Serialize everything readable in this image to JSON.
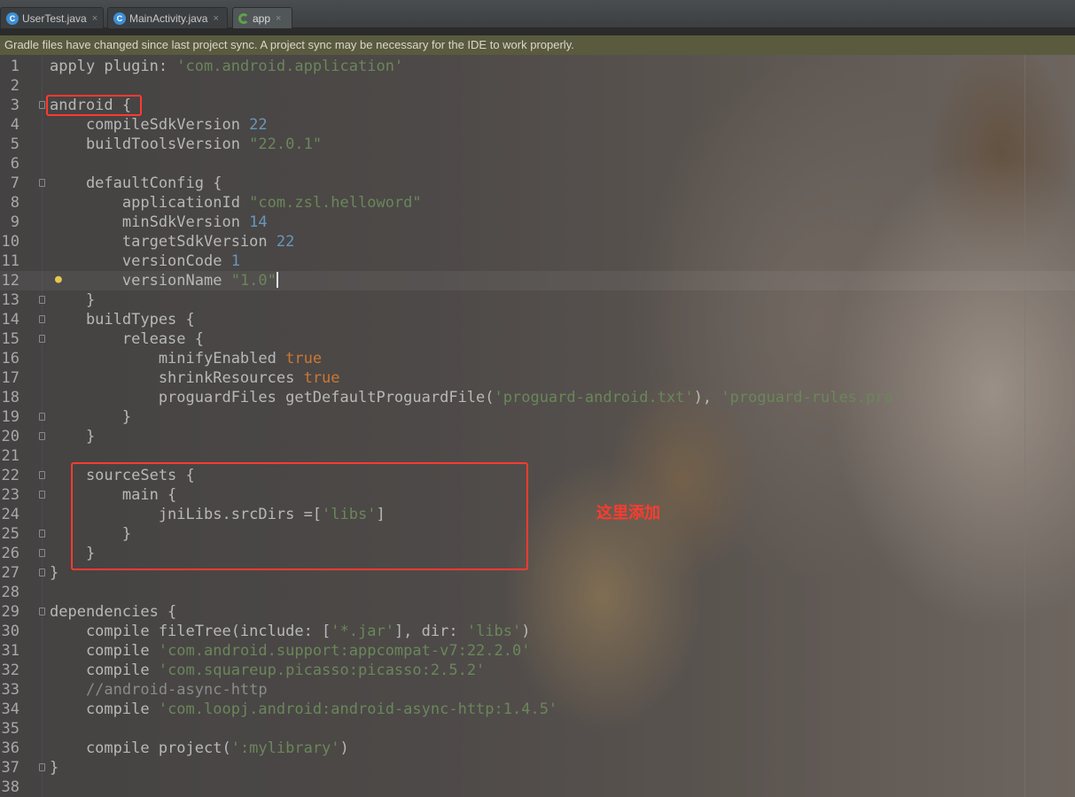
{
  "tabs": [
    {
      "label": "UserTest.java",
      "icon": "class-c-icon"
    },
    {
      "label": "MainActivity.java",
      "icon": "class-c-icon"
    },
    {
      "label": "app",
      "icon": "gradle-icon",
      "active": true
    }
  ],
  "close_glyph": "×",
  "notice": "Gradle files have changed since last project sync. A project sync may be necessary for the IDE to work properly.",
  "annotation": "这里添加",
  "editor": {
    "current_line": 12,
    "lines": [
      {
        "n": "1",
        "tokens": [
          [
            "txt",
            "apply plugin: "
          ],
          [
            "str",
            "'com.android.application'"
          ]
        ]
      },
      {
        "n": "2",
        "tokens": []
      },
      {
        "n": "3",
        "fold": true,
        "tokens": [
          [
            "txt",
            "android {"
          ]
        ]
      },
      {
        "n": "4",
        "tokens": [
          [
            "txt",
            "    compileSdkVersion "
          ],
          [
            "num",
            "22"
          ]
        ]
      },
      {
        "n": "5",
        "tokens": [
          [
            "txt",
            "    buildToolsVersion "
          ],
          [
            "str",
            "\"22.0.1\""
          ]
        ]
      },
      {
        "n": "6",
        "tokens": []
      },
      {
        "n": "7",
        "fold": true,
        "tokens": [
          [
            "txt",
            "    defaultConfig {"
          ]
        ]
      },
      {
        "n": "8",
        "tokens": [
          [
            "txt",
            "        applicationId "
          ],
          [
            "str",
            "\"com.zsl.helloword\""
          ]
        ]
      },
      {
        "n": "9",
        "tokens": [
          [
            "txt",
            "        minSdkVersion "
          ],
          [
            "num",
            "14"
          ]
        ]
      },
      {
        "n": "10",
        "tokens": [
          [
            "txt",
            "        targetSdkVersion "
          ],
          [
            "num",
            "22"
          ]
        ]
      },
      {
        "n": "11",
        "tokens": [
          [
            "txt",
            "        versionCode "
          ],
          [
            "num",
            "1"
          ]
        ]
      },
      {
        "n": "12",
        "bulb": true,
        "caret": true,
        "tokens": [
          [
            "txt",
            "        versionName "
          ],
          [
            "str",
            "\"1.0\""
          ]
        ]
      },
      {
        "n": "13",
        "fold": true,
        "tokens": [
          [
            "txt",
            "    }"
          ]
        ]
      },
      {
        "n": "14",
        "fold": true,
        "tokens": [
          [
            "txt",
            "    buildTypes {"
          ]
        ]
      },
      {
        "n": "15",
        "fold": true,
        "tokens": [
          [
            "txt",
            "        release {"
          ]
        ]
      },
      {
        "n": "16",
        "tokens": [
          [
            "txt",
            "            minifyEnabled "
          ],
          [
            "kw",
            "true"
          ]
        ]
      },
      {
        "n": "17",
        "tokens": [
          [
            "txt",
            "            shrinkResources "
          ],
          [
            "kw",
            "true"
          ]
        ]
      },
      {
        "n": "18",
        "tokens": [
          [
            "txt",
            "            proguardFiles getDefaultProguardFile("
          ],
          [
            "str",
            "'proguard-android.txt'"
          ],
          [
            "txt",
            "), "
          ],
          [
            "str",
            "'proguard-rules.pro'"
          ]
        ]
      },
      {
        "n": "19",
        "fold": true,
        "tokens": [
          [
            "txt",
            "        }"
          ]
        ]
      },
      {
        "n": "20",
        "fold": true,
        "tokens": [
          [
            "txt",
            "    }"
          ]
        ]
      },
      {
        "n": "21",
        "tokens": []
      },
      {
        "n": "22",
        "fold": true,
        "tokens": [
          [
            "txt",
            "    sourceSets {"
          ]
        ]
      },
      {
        "n": "23",
        "fold": true,
        "tokens": [
          [
            "txt",
            "        main {"
          ]
        ]
      },
      {
        "n": "24",
        "tokens": [
          [
            "txt",
            "            jniLibs.srcDirs =["
          ],
          [
            "str",
            "'libs'"
          ],
          [
            "txt",
            "]"
          ]
        ]
      },
      {
        "n": "25",
        "fold": true,
        "tokens": [
          [
            "txt",
            "        }"
          ]
        ]
      },
      {
        "n": "26",
        "fold": true,
        "tokens": [
          [
            "txt",
            "    }"
          ]
        ]
      },
      {
        "n": "27",
        "fold": true,
        "tokens": [
          [
            "txt",
            "}"
          ]
        ]
      },
      {
        "n": "28",
        "tokens": []
      },
      {
        "n": "29",
        "fold": true,
        "tokens": [
          [
            "txt",
            "dependencies {"
          ]
        ]
      },
      {
        "n": "30",
        "tokens": [
          [
            "txt",
            "    compile fileTree(include: ["
          ],
          [
            "str",
            "'*.jar'"
          ],
          [
            "txt",
            "], dir: "
          ],
          [
            "str",
            "'libs'"
          ],
          [
            "txt",
            ")"
          ]
        ]
      },
      {
        "n": "31",
        "tokens": [
          [
            "txt",
            "    compile "
          ],
          [
            "str",
            "'com.android.support:appcompat-v7:22.2.0'"
          ]
        ]
      },
      {
        "n": "32",
        "tokens": [
          [
            "txt",
            "    compile "
          ],
          [
            "str",
            "'com.squareup.picasso:picasso:2.5.2'"
          ]
        ]
      },
      {
        "n": "33",
        "tokens": [
          [
            "cmt",
            "    //android-async-http"
          ]
        ]
      },
      {
        "n": "34",
        "tokens": [
          [
            "txt",
            "    compile "
          ],
          [
            "str",
            "'com.loopj.android:android-async-http:1.4.5'"
          ]
        ]
      },
      {
        "n": "35",
        "tokens": []
      },
      {
        "n": "36",
        "tokens": [
          [
            "txt",
            "    compile project("
          ],
          [
            "str",
            "':mylibrary'"
          ],
          [
            "txt",
            ")"
          ]
        ]
      },
      {
        "n": "37",
        "fold": true,
        "tokens": [
          [
            "txt",
            "}"
          ]
        ]
      },
      {
        "n": "38",
        "tokens": []
      }
    ]
  },
  "colors": {
    "keyword": "#cc7832",
    "string": "#6a8759",
    "number": "#6897bb",
    "highlight_box": "#ff3b30"
  }
}
